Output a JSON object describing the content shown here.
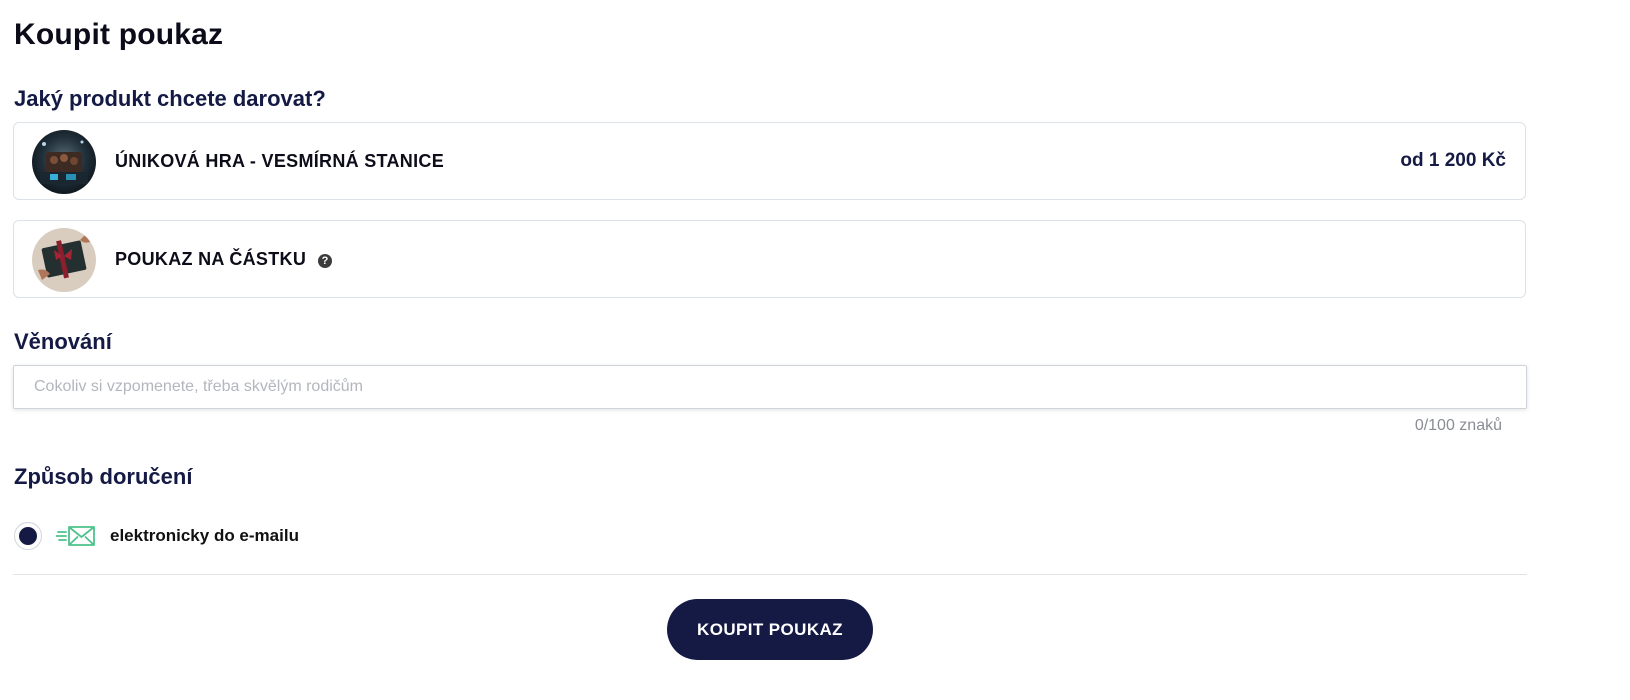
{
  "page": {
    "title": "Koupit poukaz"
  },
  "product_section": {
    "heading": "Jaký produkt chcete darovat?",
    "products": [
      {
        "name": "ÚNIKOVÁ HRA - VESMÍRNÁ STANICE",
        "price": "od 1 200 Kč",
        "image_icon": "space-station-escape-game-image"
      },
      {
        "name": "POUKAZ NA ČÁSTKU",
        "help_icon": "question-mark-icon",
        "help_glyph": "?",
        "image_icon": "gift-card-image"
      }
    ]
  },
  "dedication": {
    "heading": "Věnování",
    "value": "",
    "placeholder": "Cokoliv si vzpomenete, třeba skvělým rodičům",
    "counter": "0/100 znaků"
  },
  "delivery": {
    "heading": "Způsob doručení",
    "selected": true,
    "option_label": "elektronicky do e-mailu",
    "icon": "email-send-icon"
  },
  "actions": {
    "buy_label": "KOUPIT POUKAZ"
  },
  "colors": {
    "primary": "#151a45",
    "border": "#dde1e8",
    "icon_green": "#4cc38a"
  }
}
